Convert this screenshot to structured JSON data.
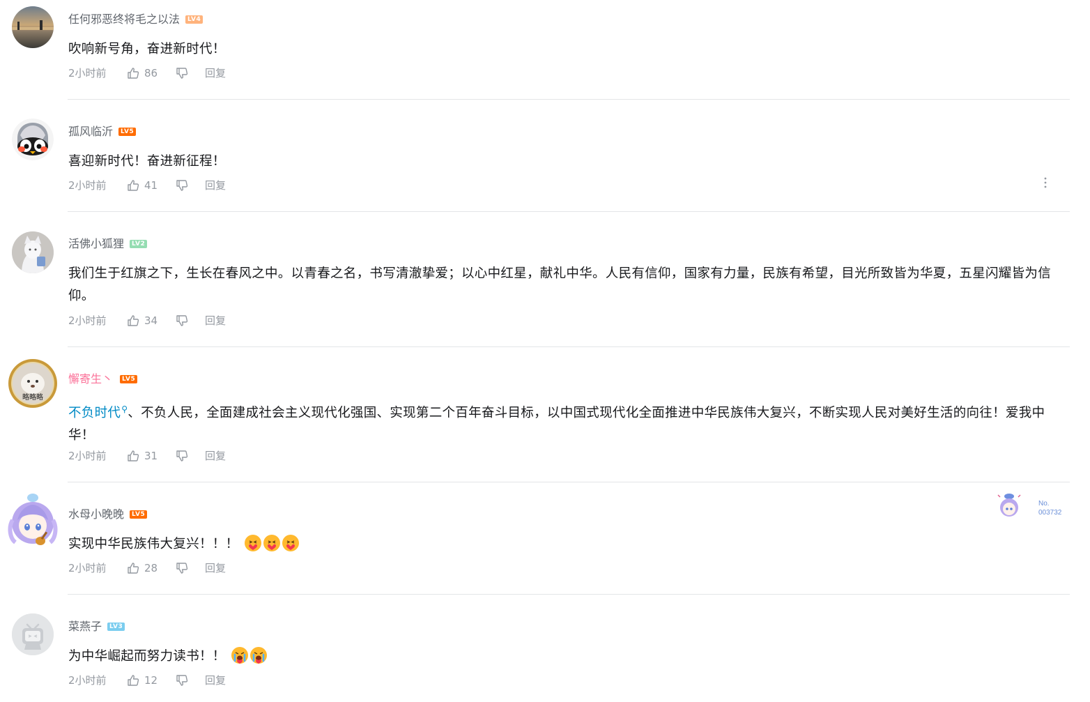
{
  "comments": [
    {
      "username": "任何邪恶终将毛之以法",
      "level": "LV4",
      "level_color": "#ffb37c",
      "content": "吹响新号角，奋进新时代！",
      "time": "2小时前",
      "likes": "86",
      "reply_label": "回复"
    },
    {
      "username": "孤风临沂",
      "level": "LV5",
      "level_color": "#ff6c00",
      "content": "喜迎新时代！奋进新征程！",
      "time": "2小时前",
      "likes": "41",
      "reply_label": "回复"
    },
    {
      "username": "活佛小狐狸",
      "level": "LV2",
      "level_color": "#95ddb2",
      "content": "我们生于红旗之下，生长在春风之中。以青春之名，书写清澈挚爱；以心中红星，献礼中华。人民有信仰，国家有力量，民族有希望，目光所致皆为华夏，五星闪耀皆为信仰。",
      "time": "2小时前",
      "likes": "34",
      "reply_label": "回复"
    },
    {
      "username": "懈寄生丶",
      "level": "LV5",
      "level_color": "#ff6c00",
      "topic": "不负时代",
      "content": "、不负人民，全面建成社会主义现代化强国、实现第二个百年奋斗目标，以中国式现代化全面推进中华民族伟大复兴，不断实现人民对美好生活的向往！爱我中华！",
      "avatar_caption": "略略略",
      "time": "2小时前",
      "likes": "31",
      "reply_label": "回复"
    },
    {
      "username": "水母小晚晚",
      "level": "LV5",
      "level_color": "#ff6c00",
      "content": "实现中华民族伟大复兴！！！",
      "time": "2小时前",
      "likes": "28",
      "reply_label": "回复",
      "fan_badge_no": "No.",
      "fan_badge_num": "003732"
    },
    {
      "username": "菜燕子",
      "level": "LV3",
      "level_color": "#7bcdef",
      "content": "为中华崛起而努力读书！！",
      "time": "2小时前",
      "likes": "12",
      "reply_label": "回复"
    }
  ]
}
